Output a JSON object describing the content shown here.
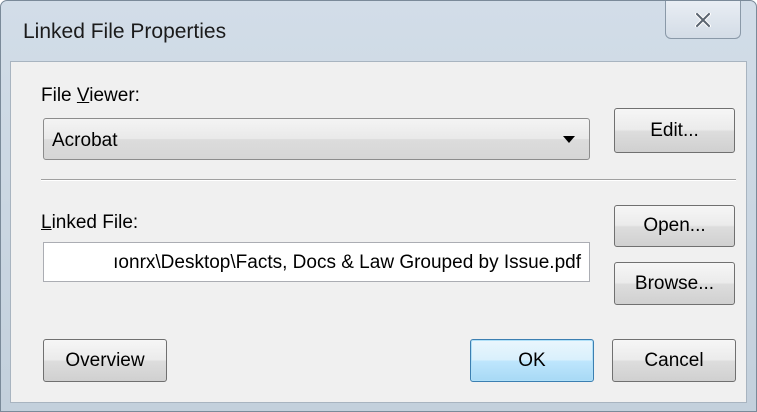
{
  "window": {
    "title": "Linked File Properties",
    "close_icon": "close-icon"
  },
  "file_viewer": {
    "label_prefix": "File ",
    "label_underlined": "V",
    "label_suffix": "iewer:",
    "selected": "Acrobat",
    "edit_label": "Edit..."
  },
  "linked_file": {
    "label_underlined": "L",
    "label_suffix": "inked File:",
    "value": "ıonrx\\Desktop\\Facts, Docs & Law Grouped by Issue.pdf",
    "open_label": "Open...",
    "browse_label": "Browse..."
  },
  "footer": {
    "overview_label": "Overview",
    "ok_label": "OK",
    "cancel_label": "Cancel"
  },
  "colors": {
    "title_bar": "#c9d6e2",
    "client_bg": "#f0f0f0",
    "default_button_border": "#3c7fb1"
  }
}
